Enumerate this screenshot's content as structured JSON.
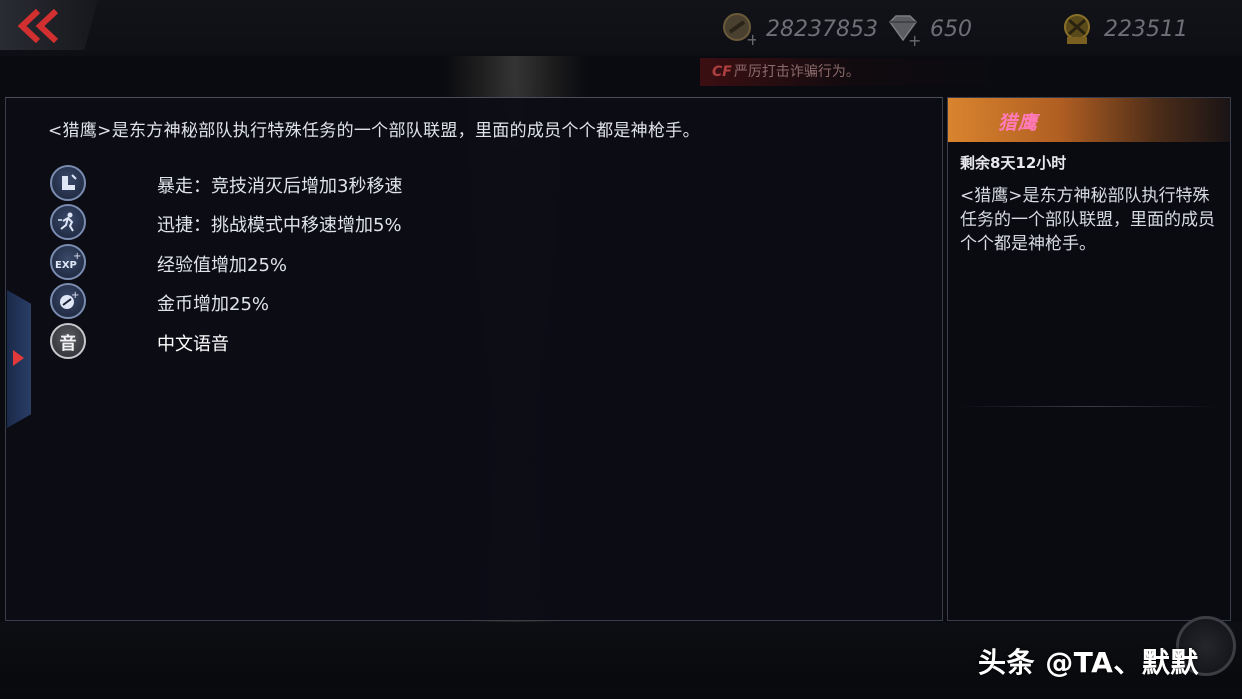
{
  "header": {
    "currencies": [
      {
        "icon": "gold-coin-icon",
        "value": "28237853"
      },
      {
        "icon": "diamond-icon",
        "value": "650"
      },
      {
        "icon": "honor-badge-icon",
        "value": "223511"
      }
    ],
    "notice": {
      "logo": "CF",
      "text": "严厉打击诈骗行为。"
    }
  },
  "main": {
    "description": "<猎鹰>是东方神秘部队执行特殊任务的一个部队联盟，里面的成员个个都是神枪手。",
    "perks": [
      {
        "icon": "rampage-boot-icon",
        "label": "暴走：竞技消灭后增加3秒移速"
      },
      {
        "icon": "sprint-runner-icon",
        "label": "迅捷：挑战模式中移速增加5%"
      },
      {
        "icon": "exp-boost-icon",
        "label": "经验值增加25%"
      },
      {
        "icon": "coin-boost-icon",
        "label": "金币增加25%"
      },
      {
        "icon": "voice-icon",
        "icon_glyph": "音",
        "label": "中文语音"
      }
    ]
  },
  "info": {
    "title": "猎鹰",
    "remaining": "剩余8天12小时",
    "description": "<猎鹰>是东方神秘部队执行特殊任务的一个部队联盟，里面的成员个个都是神枪手。"
  },
  "watermark": "头条 @TA、默默",
  "colors": {
    "header_orange": "#d9842e",
    "title_pink": "#ff7ab8",
    "panel_bg": "#0c0d16",
    "tab_arrow_red": "#e23a3a"
  }
}
